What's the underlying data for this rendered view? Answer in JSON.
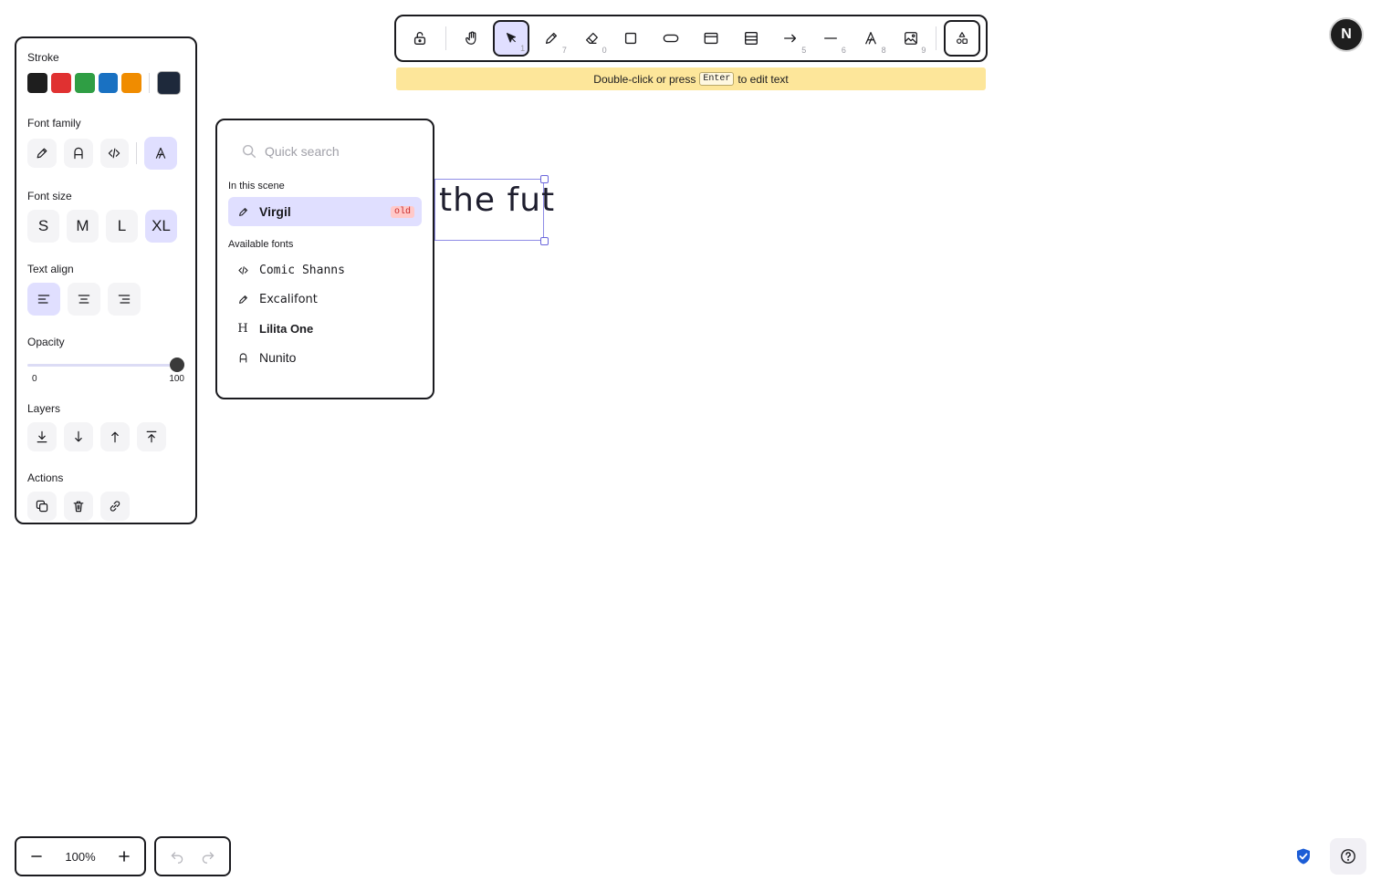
{
  "toolbar": {
    "tools": [
      {
        "id": "lock",
        "icon": "lock-icon",
        "key": ""
      },
      {
        "id": "hand",
        "icon": "hand-icon",
        "key": ""
      },
      {
        "id": "selection",
        "icon": "pointer-icon",
        "key": "1",
        "active": true
      },
      {
        "id": "freedraw",
        "icon": "pencil-icon",
        "key": "7"
      },
      {
        "id": "eraser",
        "icon": "eraser-icon",
        "key": "0"
      },
      {
        "id": "rectangle",
        "icon": "rectangle-icon",
        "key": ""
      },
      {
        "id": "ellipse",
        "icon": "ellipse-icon",
        "key": ""
      },
      {
        "id": "frame",
        "icon": "frame-icon",
        "key": ""
      },
      {
        "id": "embed",
        "icon": "embed-icon",
        "key": ""
      },
      {
        "id": "arrow",
        "icon": "arrow-icon",
        "key": "5"
      },
      {
        "id": "line",
        "icon": "line-icon",
        "key": "6"
      },
      {
        "id": "text",
        "icon": "text-icon",
        "key": "8"
      },
      {
        "id": "image",
        "icon": "image-icon",
        "key": "9"
      },
      {
        "id": "extra",
        "icon": "shapes-icon",
        "key": ""
      }
    ]
  },
  "hint": {
    "before": "Double-click or press",
    "key": "Enter",
    "after": "to edit text"
  },
  "avatar": {
    "initial": "N"
  },
  "properties": {
    "stroke_label": "Stroke",
    "stroke_colors": [
      "#1e1e1e",
      "#e03131",
      "#2f9e44",
      "#1971c2",
      "#f08c00"
    ],
    "current_stroke": "#1e293b",
    "font_family_label": "Font family",
    "font_size_label": "Font size",
    "font_sizes": [
      "S",
      "M",
      "L",
      "XL"
    ],
    "selected_font_size": "XL",
    "text_align_label": "Text align",
    "opacity_label": "Opacity",
    "opacity_min": "0",
    "opacity_max": "100",
    "opacity_value": 100,
    "layers_label": "Layers",
    "actions_label": "Actions"
  },
  "font_picker": {
    "search_placeholder": "Quick search",
    "in_scene_label": "In this scene",
    "in_scene": [
      {
        "name": "Virgil",
        "badge": "old",
        "icon": "pencil-icon"
      }
    ],
    "available_label": "Available fonts",
    "available": [
      {
        "name": "Comic Shanns",
        "icon": "code-icon"
      },
      {
        "name": "Excalifont",
        "icon": "pencil-icon"
      },
      {
        "name": "Lilita One",
        "icon": "heading-icon"
      },
      {
        "name": "Nunito",
        "icon": "sans-a-icon"
      }
    ]
  },
  "canvas": {
    "text": "the fut"
  },
  "zoom": {
    "value": "100%"
  },
  "colors": {
    "accent": "#6965db",
    "selection_bg": "#e0dfff",
    "hint_bg": "#fde69a"
  }
}
